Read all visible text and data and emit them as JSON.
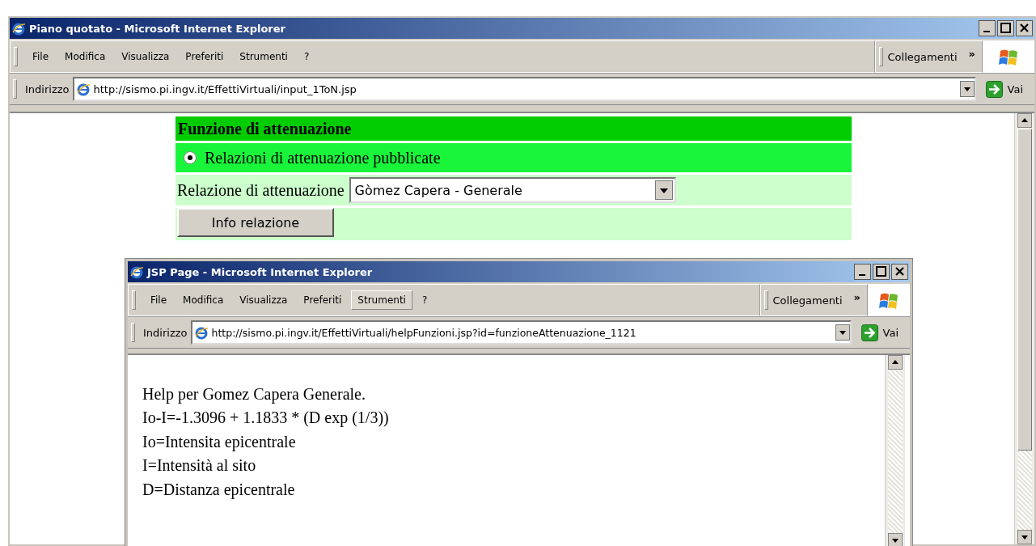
{
  "main_window": {
    "title": "Piano quotato - Microsoft Internet Explorer",
    "menu": [
      {
        "label": "File",
        "selected": false
      },
      {
        "label": "Modifica",
        "selected": false
      },
      {
        "label": "Visualizza",
        "selected": false
      },
      {
        "label": "Preferiti",
        "selected": false
      },
      {
        "label": "Strumenti",
        "selected": false
      },
      {
        "label": "?",
        "selected": false
      }
    ],
    "links_label": "Collegamenti",
    "chevron": "»",
    "address_label": "Indirizzo",
    "url": "http://sismo.pi.ingv.it/EffettiVirtuali/input_1ToN.jsp",
    "go_label": "Vai"
  },
  "form": {
    "section_title": "Funzione di attenuazione",
    "radio": {
      "label": "Relazioni di attenuazione pubblicate",
      "checked": true
    },
    "select_label": "Relazione di attenuazione",
    "select_value": "Gòmez Capera - Generale",
    "info_button": "Info relazione"
  },
  "popup": {
    "title": "JSP Page - Microsoft Internet Explorer",
    "menu": [
      {
        "label": "File",
        "selected": false
      },
      {
        "label": "Modifica",
        "selected": false
      },
      {
        "label": "Visualizza",
        "selected": false
      },
      {
        "label": "Preferiti",
        "selected": false
      },
      {
        "label": "Strumenti",
        "selected": true
      },
      {
        "label": "?",
        "selected": false
      }
    ],
    "links_label": "Collegamenti",
    "chevron": "»",
    "address_label": "Indirizzo",
    "url": "http://sismo.pi.ingv.it/EffettiVirtuali/helpFunzioni.jsp?id=funzioneAttenuazione_1121",
    "go_label": "Vai",
    "help_lines": [
      "Help per Gomez Capera Generale.",
      "Io-I=-1.3096 + 1.1833 * (D exp (1/3))",
      "Io=Intensita epicentrale",
      "I=Intensità al sito",
      "D=Distanza epicentrale"
    ]
  }
}
